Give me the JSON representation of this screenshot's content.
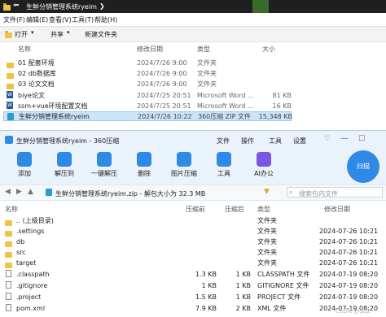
{
  "explorer": {
    "title": "生鲜分销管理系统ryeim",
    "toolbar": {
      "open": "打开",
      "share": "共享",
      "new_folder": "新建文件夹"
    },
    "menu": [
      "文件(F)",
      "编辑(E)",
      "查看(V)",
      "工具(T)",
      "帮助(H)"
    ],
    "columns": {
      "name": "名称",
      "date": "修改日期",
      "type": "类型",
      "size": "大小"
    },
    "files": [
      {
        "name": "01 配套环境",
        "date": "2024/7/26 9:00",
        "type": "文件夹",
        "size": "",
        "icon": "folder"
      },
      {
        "name": "02 db数据库",
        "date": "2024/7/26 9:00",
        "type": "文件夹",
        "size": "",
        "icon": "folder"
      },
      {
        "name": "03 论文文档",
        "date": "2024/7/26 9:00",
        "type": "文件夹",
        "size": "",
        "icon": "folder"
      },
      {
        "name": "biye论文",
        "date": "2024/7/25 20:51",
        "type": "Microsoft Word ...",
        "size": "81 KB",
        "icon": "word"
      },
      {
        "name": "ssm+vue环境配置文档",
        "date": "2024/7/25 20:51",
        "type": "Microsoft Word ...",
        "size": "16 KB",
        "icon": "word"
      },
      {
        "name": "生鲜分销管理系统ryeim",
        "date": "2024/7/26 10:22",
        "type": "360压缩 ZIP 文件",
        "size": "15,348 KB",
        "icon": "zip"
      }
    ]
  },
  "zipapp": {
    "title": "生鲜分销管理系统ryeim - 360压缩",
    "title_menu": [
      "文件",
      "操作",
      "工具",
      "设置"
    ],
    "tools": [
      {
        "label": "添加",
        "icon": "add-icon",
        "color": "#2f8ae6"
      },
      {
        "label": "解压到",
        "icon": "extract-icon",
        "color": "#2f8ae6"
      },
      {
        "label": "一键解压",
        "icon": "one-click-extract-icon",
        "color": "#2f8ae6"
      },
      {
        "label": "删除",
        "icon": "delete-icon",
        "color": "#2f8ae6"
      },
      {
        "label": "图片压缩",
        "icon": "image-compress-icon",
        "color": "#2f8ae6"
      },
      {
        "label": "工具",
        "icon": "tools-icon",
        "color": "#2f8ae6"
      },
      {
        "label": "AI办公",
        "icon": "ai-office-icon",
        "color": "#7b55e6"
      }
    ],
    "scan_label": "扫描",
    "path": "生鲜分销管理系统ryeim.zip - 解包大小为 32.3 MB",
    "search_placeholder": "搜索包内文件",
    "columns": {
      "name": "名称",
      "compressed": "压缩前",
      "after": "压缩后",
      "type": "类型",
      "date": "修改日期"
    },
    "files": [
      {
        "name": ".. (上级目录)",
        "compressed": "",
        "after": "",
        "type": "文件夹",
        "date": "",
        "icon": "folder"
      },
      {
        "name": ".settings",
        "compressed": "",
        "after": "",
        "type": "文件夹",
        "date": "2024-07-26 10:21",
        "icon": "folder"
      },
      {
        "name": "db",
        "compressed": "",
        "after": "",
        "type": "文件夹",
        "date": "2024-07-26 10:21",
        "icon": "folder"
      },
      {
        "name": "src",
        "compressed": "",
        "after": "",
        "type": "文件夹",
        "date": "2024-07-26 10:21",
        "icon": "folder"
      },
      {
        "name": "target",
        "compressed": "",
        "after": "",
        "type": "文件夹",
        "date": "2024-07-26 10:21",
        "icon": "folder"
      },
      {
        "name": ".classpath",
        "compressed": "1.3 KB",
        "after": "1 KB",
        "type": "CLASSPATH 文件",
        "date": "2024-07-19 08:20",
        "icon": "file"
      },
      {
        "name": ".gitignore",
        "compressed": "1 KB",
        "after": "1 KB",
        "type": "GITIGNORE 文件",
        "date": "2024-07-19 08:20",
        "icon": "file"
      },
      {
        "name": ".project",
        "compressed": "1.5 KB",
        "after": "1 KB",
        "type": "PROJECT 文件",
        "date": "2024-07-19 08:20",
        "icon": "file"
      },
      {
        "name": "pom.xml",
        "compressed": "7.9 KB",
        "after": "2 KB",
        "type": "XML 文件",
        "date": "2024-07-19 08:20",
        "icon": "file"
      }
    ],
    "watermark": "CSDN @qq2"
  }
}
